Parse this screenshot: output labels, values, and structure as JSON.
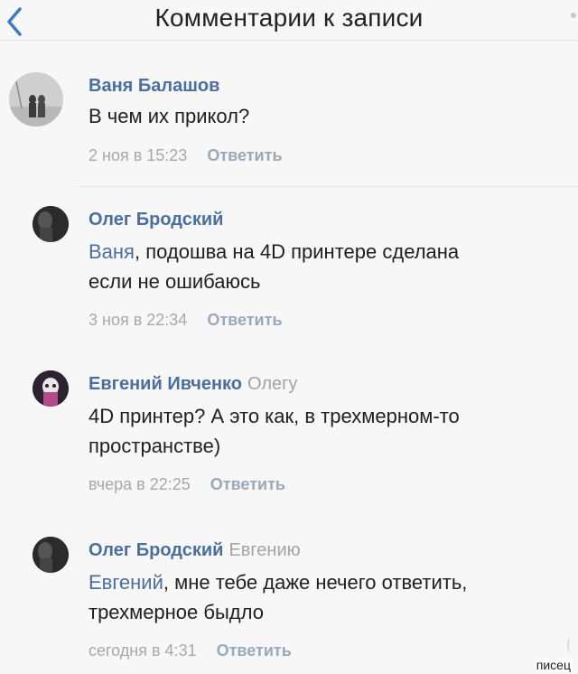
{
  "header": {
    "title": "Комментарии к записи"
  },
  "comments": [
    {
      "author": "Ваня Балашов",
      "reply_to": "",
      "mention": "",
      "line1": "В чем их прикол?",
      "line2": "",
      "time": "2 ноя в 15:23",
      "reply_label": "Ответить"
    },
    {
      "author": "Олег Бродский",
      "reply_to": "",
      "mention": "Ваня",
      "line1": ", подошва на 4D принтере сделана",
      "line2": "если не ошибаюсь",
      "time": "3 ноя в 22:34",
      "reply_label": "Ответить"
    },
    {
      "author": "Евгений Ивченко",
      "reply_to": "Олегу",
      "mention": "",
      "line1": "4D принтер? А это как, в трехмерном-то",
      "line2": "пространстве)",
      "time": "вчера в 22:25",
      "reply_label": "Ответить"
    },
    {
      "author": "Олег Бродский",
      "reply_to": "Евгению",
      "mention": "Евгений",
      "line1": ", мне тебе даже нечего ответить,",
      "line2": "трехмерное быдло",
      "time": "сегодня в 4:31",
      "reply_label": "Ответить"
    }
  ],
  "watermark": "писец",
  "colors": {
    "name": "#4b6f9c",
    "meta": "#a8a8a8",
    "reply": "#9aa8b9",
    "back": "#3f7ac3"
  }
}
